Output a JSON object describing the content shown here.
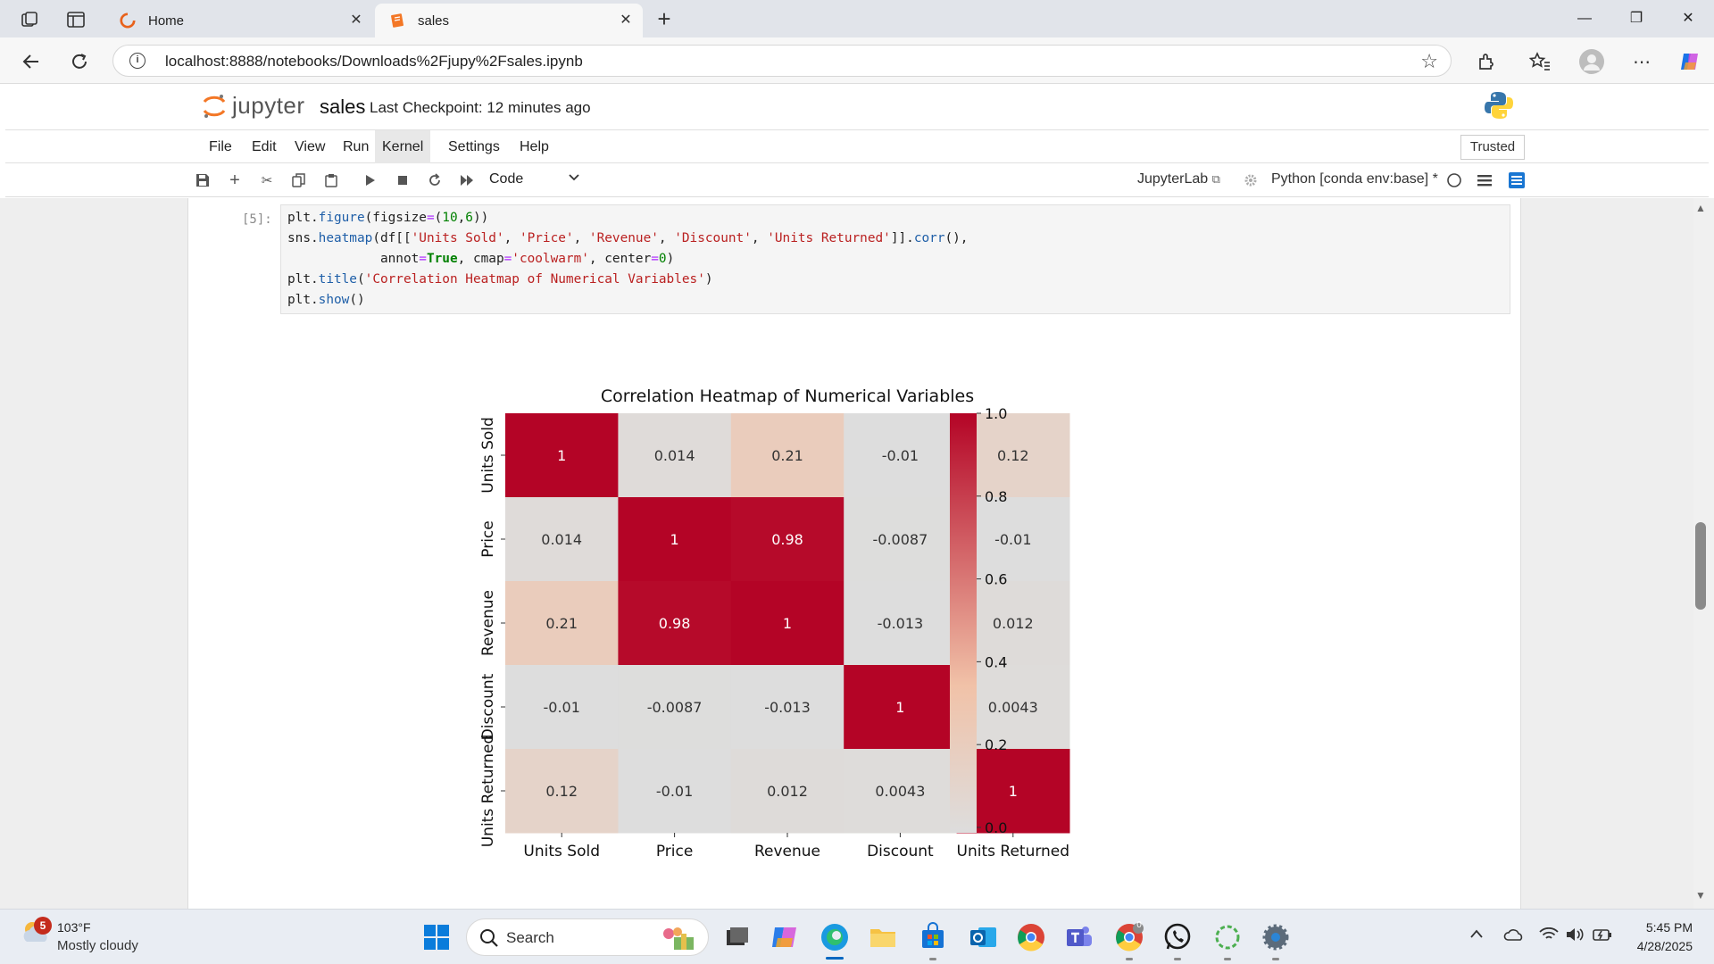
{
  "browser": {
    "tabs": [
      {
        "label": "Home",
        "icon": "edge-home-icon"
      },
      {
        "label": "sales",
        "icon": "jupyter-notebook-icon"
      }
    ],
    "url": "localhost:8888/notebooks/Downloads%2Fjupy%2Fsales.ipynb"
  },
  "jupyter": {
    "logo_text": "jupyter",
    "notebook_name": "sales",
    "checkpoint": "Last Checkpoint: 12 minutes ago",
    "menu": [
      "File",
      "Edit",
      "View",
      "Run",
      "Kernel",
      "Settings",
      "Help"
    ],
    "trusted": "Trusted",
    "cell_type": "Code",
    "jupyterlab_link": "JupyterLab",
    "kernel": "Python [conda env:base] *"
  },
  "cell": {
    "prompt": "[5]:",
    "code_lines": [
      "plt.figure(figsize=(10,6))",
      "sns.heatmap(df[['Units Sold', 'Price', 'Revenue', 'Discount', 'Units Returned']].corr(),",
      "            annot=True, cmap='coolwarm', center=0)",
      "plt.title('Correlation Heatmap of Numerical Variables')",
      "plt.show()"
    ]
  },
  "chart_data": {
    "type": "heatmap",
    "title": "Correlation Heatmap of Numerical Variables",
    "x_labels": [
      "Units Sold",
      "Price",
      "Revenue",
      "Discount",
      "Units Returned"
    ],
    "y_labels": [
      "Units Sold",
      "Price",
      "Revenue",
      "Discount",
      "Units Returned"
    ],
    "values": [
      [
        1,
        0.014,
        0.21,
        -0.01,
        0.12
      ],
      [
        0.014,
        1,
        0.98,
        -0.0087,
        -0.01
      ],
      [
        0.21,
        0.98,
        1,
        -0.013,
        0.012
      ],
      [
        -0.01,
        -0.0087,
        -0.013,
        1,
        0.0043
      ],
      [
        0.12,
        -0.01,
        0.012,
        0.0043,
        1
      ]
    ],
    "annotations": [
      [
        "1",
        "0.014",
        "0.21",
        "-0.01",
        "0.12"
      ],
      [
        "0.014",
        "1",
        "0.98",
        "-0.0087",
        "-0.01"
      ],
      [
        "0.21",
        "0.98",
        "1",
        "-0.013",
        "0.012"
      ],
      [
        "-0.01",
        "-0.0087",
        "-0.013",
        "1",
        "0.0043"
      ],
      [
        "0.12",
        "-0.01",
        "0.012",
        "0.0043",
        "1"
      ]
    ],
    "colorbar_ticks": [
      "0.0",
      "0.2",
      "0.4",
      "0.6",
      "0.8",
      "1.0"
    ],
    "colorbar_range": [
      -0.013,
      1.0
    ],
    "colormap": "coolwarm (center=0)",
    "colors": {
      "low": "#dddddd",
      "mid": "#f1c2a8",
      "high": "#b40426"
    }
  },
  "taskbar": {
    "weather_badge": "5",
    "weather_temp": "103°F",
    "weather_cond": "Mostly cloudy",
    "search_label": "Search",
    "time": "5:45 PM",
    "date": "4/28/2025",
    "teams_badge": "0"
  }
}
